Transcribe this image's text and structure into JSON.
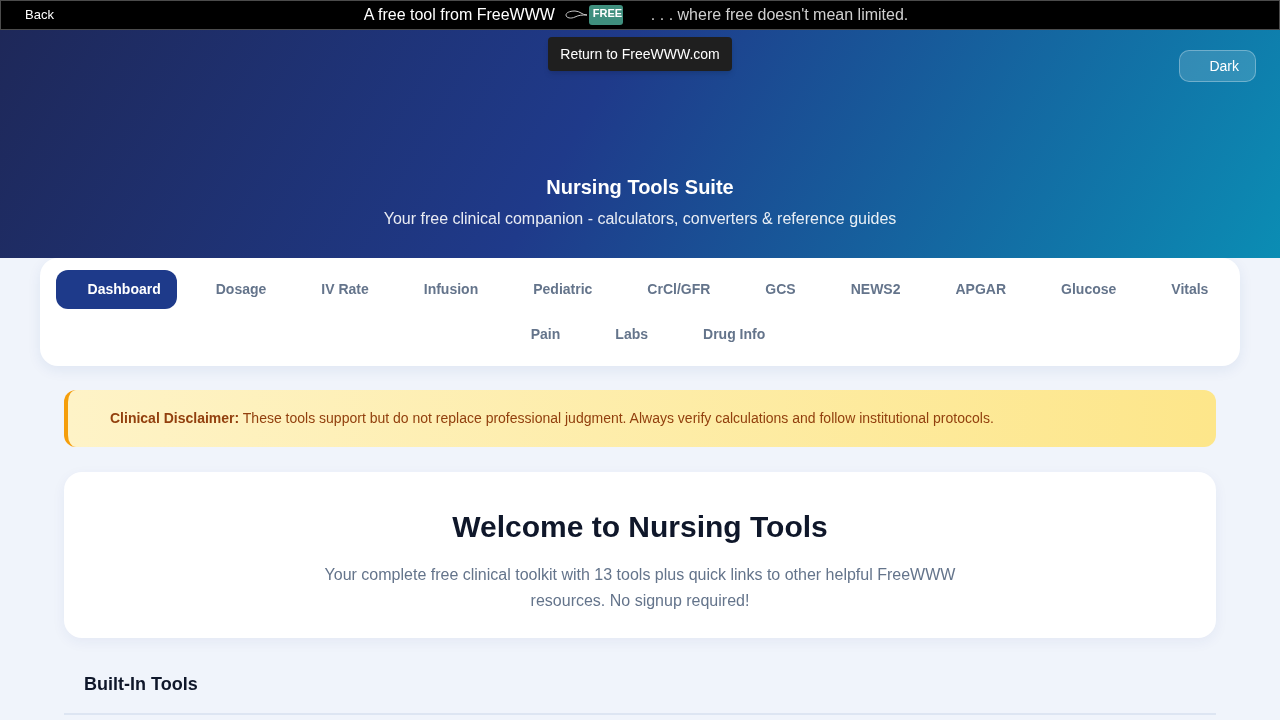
{
  "top_bar": {
    "back": "Back",
    "tagline": "A free tool from FreeWWW",
    "logo": {
      "text": "FREE"
    },
    "slogan": ". . . where free doesn't mean limited.",
    "tooltip": "Return to FreeWWW.com"
  },
  "header": {
    "theme_button": "Dark",
    "title": "Nursing Tools Suite",
    "subtitle": "Your free clinical companion - calculators, converters & reference guides"
  },
  "tabs": [
    {
      "label": "Dashboard",
      "selected": true
    },
    {
      "label": "Dosage",
      "selected": false
    },
    {
      "label": "IV Rate",
      "selected": false
    },
    {
      "label": "Infusion",
      "selected": false
    },
    {
      "label": "Pediatric",
      "selected": false
    },
    {
      "label": "CrCl/GFR",
      "selected": false
    },
    {
      "label": "GCS",
      "selected": false
    },
    {
      "label": "NEWS2",
      "selected": false
    },
    {
      "label": "APGAR",
      "selected": false
    },
    {
      "label": "Glucose",
      "selected": false
    },
    {
      "label": "Vitals",
      "selected": false
    },
    {
      "label": "Pain",
      "selected": false
    },
    {
      "label": "Labs",
      "selected": false
    },
    {
      "label": "Drug Info",
      "selected": false
    }
  ],
  "disclaimer": "**Clinical Disclaimer:** These tools support but do not replace professional judgment. Always verify calculations and follow institutional protocols.",
  "welcome": {
    "title": "Welcome to Nursing Tools",
    "text": "Your complete free clinical toolkit with 13 tools plus quick links to other helpful FreeWWW resources. No signup required!"
  },
  "section": {
    "title": "Built-In Tools"
  }
}
